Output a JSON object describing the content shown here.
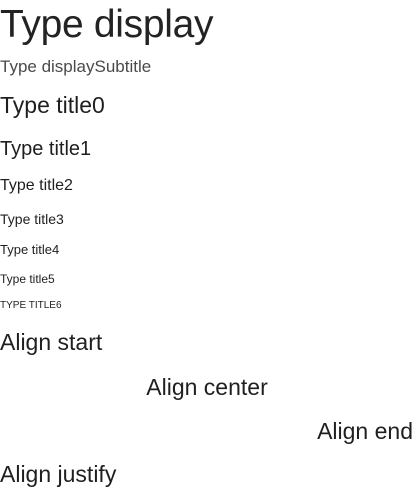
{
  "typography": {
    "display": "Type display",
    "display_subtitle": "Type displaySubtitle",
    "title0": "Type title0",
    "title1": "Type title1",
    "title2": "Type title2",
    "title3": "Type title3",
    "title4": "Type title4",
    "title5": "Type title5",
    "title6": "Type title6"
  },
  "alignment": {
    "start": "Align start",
    "center": "Align center",
    "end": "Align end",
    "justify": "Align justify"
  }
}
